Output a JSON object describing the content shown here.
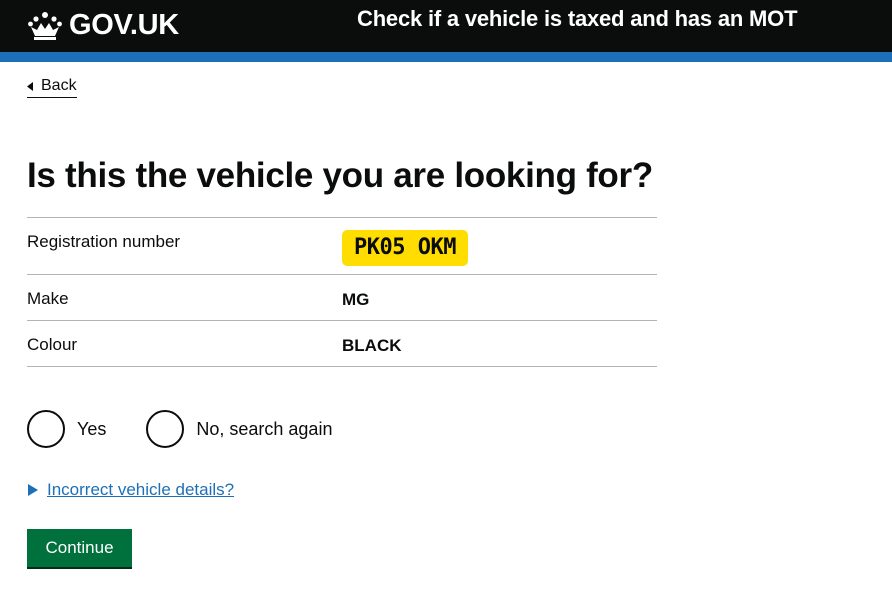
{
  "header": {
    "logo_text": "GOV.UK",
    "service_name": "Check if a vehicle is taxed and has an MOT"
  },
  "back_link": {
    "label": "Back"
  },
  "page": {
    "heading": "Is this the vehicle you are looking for?"
  },
  "vehicle": {
    "rows": [
      {
        "key": "Registration number",
        "value": "PK05 OKM"
      },
      {
        "key": "Make",
        "value": "MG"
      },
      {
        "key": "Colour",
        "value": "BLACK"
      }
    ]
  },
  "radios": {
    "options": [
      {
        "label": "Yes",
        "selected": false
      },
      {
        "label": "No, search again",
        "selected": false
      }
    ]
  },
  "details": {
    "summary": "Incorrect vehicle details?"
  },
  "actions": {
    "continue_label": "Continue"
  },
  "colors": {
    "header_bg": "#0b0c0c",
    "header_accent": "#1d70b8",
    "link": "#1d70b8",
    "button": "#00703c",
    "plate": "#ffdd00"
  }
}
